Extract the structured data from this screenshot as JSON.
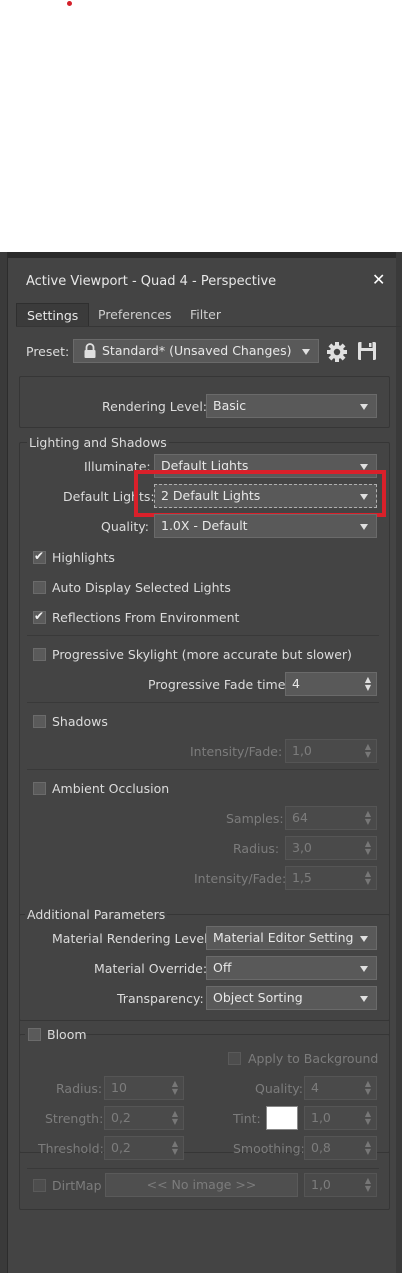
{
  "dialog": {
    "title": "Active Viewport - Quad 4 - Perspective",
    "close_label": "✕"
  },
  "tabs": [
    {
      "label": "Settings"
    },
    {
      "label": "Preferences"
    },
    {
      "label": "Filter"
    }
  ],
  "preset": {
    "label": "Preset:",
    "value": "Standard* (Unsaved Changes)"
  },
  "rendering_level": {
    "label": "Rendering Level:",
    "value": "Basic"
  },
  "lighting": {
    "header": "Lighting and Shadows",
    "illuminate": {
      "label": "Illuminate:",
      "value": "Default Lights"
    },
    "default_lights": {
      "label": "Default Lights:",
      "value": "2 Default Lights"
    },
    "quality": {
      "label": "Quality:",
      "value": "1.0X - Default"
    },
    "highlights": "Highlights",
    "auto_display": "Auto Display Selected Lights",
    "reflections": "Reflections From Environment",
    "progressive_skylight": "Progressive Skylight (more accurate but slower)",
    "fade_time": {
      "label": "Progressive Fade time:",
      "value": "4"
    },
    "shadows": "Shadows",
    "intensity_fade": {
      "label": "Intensity/Fade:",
      "value": "1,0"
    },
    "ambient_occlusion": "Ambient Occlusion",
    "samples": {
      "label": "Samples:",
      "value": "64"
    },
    "radius": {
      "label": "Radius:",
      "value": "3,0"
    },
    "ao_intensity": {
      "label": "Intensity/Fade:",
      "value": "1,5"
    }
  },
  "additional": {
    "header": "Additional Parameters",
    "material_rendering": {
      "label": "Material Rendering Level:",
      "value": "Material Editor Setting"
    },
    "material_override": {
      "label": "Material Override:",
      "value": "Off"
    },
    "transparency": {
      "label": "Transparency:",
      "value": "Object Sorting"
    }
  },
  "bloom": {
    "header": "Bloom",
    "apply_bg": "Apply to Background",
    "radius": {
      "label": "Radius:",
      "value": "10"
    },
    "quality": {
      "label": "Quality:",
      "value": "4"
    },
    "strength": {
      "label": "Strength:",
      "value": "0,2"
    },
    "tint": {
      "label": "Tint:",
      "value": "1,0",
      "color": "#ffffff"
    },
    "threshold": {
      "label": "Threshold:",
      "value": "0,2"
    },
    "smoothing": {
      "label": "Smoothing:",
      "value": "0,8"
    },
    "dirtmap": {
      "label": "DirtMap",
      "button": "<< No image >>",
      "value": "1,0"
    }
  },
  "spinner_glyph": "▲\n▼"
}
